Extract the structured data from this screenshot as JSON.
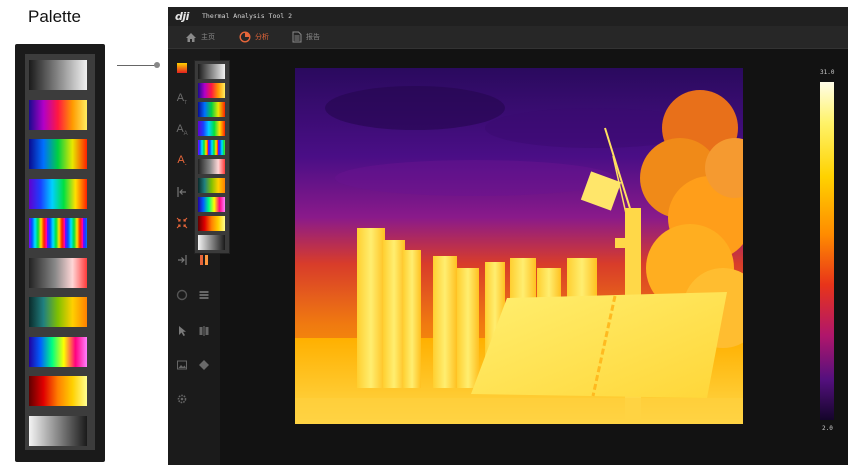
{
  "label": {
    "palette": "Palette"
  },
  "app": {
    "logo": "dji",
    "title": "Thermal Analysis Tool 2"
  },
  "nav": {
    "home": "主页",
    "analyze": "分析",
    "report": "报告",
    "active": "analyze"
  },
  "scale": {
    "max": "31.0",
    "min": "2.0"
  },
  "colors": {
    "accent": "#e7663a",
    "background": "#121212"
  },
  "icons": [
    "home-icon",
    "pie-chart-icon",
    "document-icon",
    "palette-icon",
    "text-icon",
    "text-size-icon",
    "text-color-icon",
    "range-left-icon",
    "collapse-icon",
    "range-right-icon",
    "isotherm-icon",
    "layers-icon",
    "cursor-icon",
    "split-icon",
    "image-icon",
    "diamond-icon",
    "settings-icon"
  ],
  "palettes": [
    "white-hot",
    "fulgurite",
    "iron-red",
    "hot-iron",
    "medical",
    "arctic",
    "rainbow-1",
    "rainbow-2",
    "tint",
    "black-hot"
  ]
}
